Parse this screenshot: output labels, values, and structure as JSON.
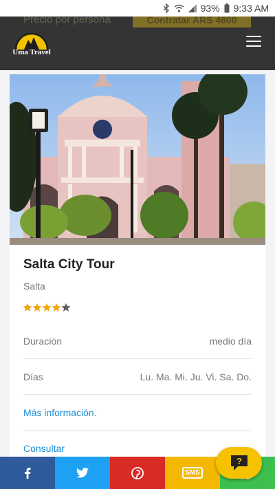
{
  "status_bar": {
    "battery": "93%",
    "time": "9:33 AM"
  },
  "header": {
    "brand": "Uma Travel",
    "ghost_price_label": "Precio por persona",
    "ghost_cta": "Contratar ARS 4600",
    "menu_icon": "hamburger-menu-icon"
  },
  "tour": {
    "title": "Salta City Tour",
    "location": "Salta",
    "rating": 4,
    "rating_max": 5,
    "details": [
      {
        "label": "Duración",
        "value": "medio día"
      },
      {
        "label": "Días",
        "value": "Lu. Ma. Mi. Ju. Vi. Sa. Do."
      }
    ],
    "more_info_link": "Más información.",
    "inquiry_link": "Consultar"
  },
  "share_bar": {
    "items": [
      {
        "name": "facebook",
        "icon": "facebook-icon",
        "color": "#2f5a9b"
      },
      {
        "name": "twitter",
        "icon": "twitter-icon",
        "color": "#1da1f2"
      },
      {
        "name": "pinterest",
        "icon": "pinterest-icon",
        "color": "#d92a26"
      },
      {
        "name": "sms",
        "icon": "sms-icon",
        "label": "SMS",
        "color": "#f5b800"
      },
      {
        "name": "whatsapp",
        "icon": "whatsapp-icon",
        "color": "#3cbf4c"
      }
    ]
  },
  "chat": {
    "icon": "help-chat-icon",
    "glyph": "?"
  },
  "colors": {
    "accent": "#1a8fd8",
    "star": "#f0a50a",
    "header_bg": "#343434",
    "chat_bg": "#f6c200"
  }
}
